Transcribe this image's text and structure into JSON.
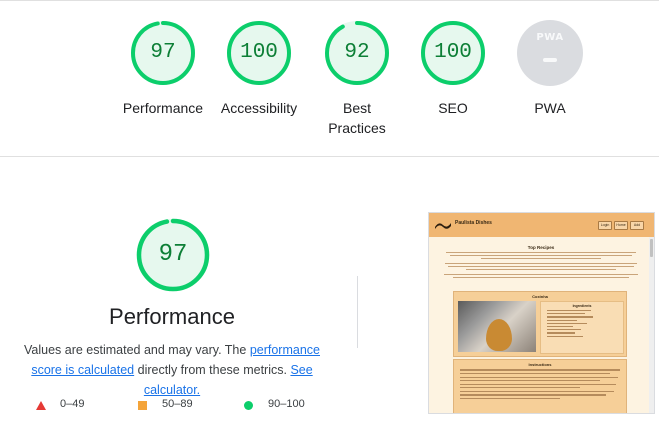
{
  "categories": [
    {
      "label": "Performance",
      "score": "97",
      "status": "pass"
    },
    {
      "label": "Accessibility",
      "score": "100",
      "status": "pass"
    },
    {
      "label": "Best Practices",
      "score": "92",
      "status": "pass"
    },
    {
      "label": "SEO",
      "score": "100",
      "status": "pass"
    },
    {
      "label": "PWA",
      "badge_text": "PWA",
      "status": "na"
    }
  ],
  "performance": {
    "score": "97",
    "title": "Performance",
    "desc_pre": "Values are estimated and may vary. The ",
    "link_score": "performance score is calculated",
    "desc_mid": " directly from these metrics. ",
    "link_calc": "See calculator."
  },
  "legend": [
    {
      "shape": "triangle",
      "color": "#e53935",
      "range": "0–49"
    },
    {
      "shape": "square",
      "color": "#f4a43a",
      "range": "50–89"
    },
    {
      "shape": "circle",
      "color": "#0cce6b",
      "range": "90–100"
    }
  ],
  "screenshot": {
    "site_name": "Paulista Dishes",
    "nav_buttons": [
      "Login",
      "Home",
      "Add"
    ],
    "intro_heading": "Top Recipes",
    "card_heading": "Coxinha",
    "ingredients_heading": "Ingredients",
    "directions_heading": "Instructions"
  },
  "colors": {
    "pass": "#0cce6b",
    "pass_text": "#0d7f36",
    "pass_fill": "#e6f8ee",
    "na": "#dadce0",
    "link": "#1a73e8"
  }
}
